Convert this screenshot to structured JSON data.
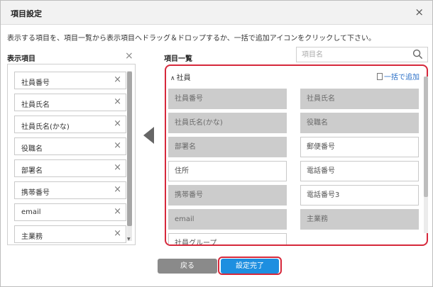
{
  "dialog": {
    "title": "項目設定",
    "close_glyph": "×"
  },
  "instruction": "表示する項目を、項目一覧から表示項目へドラッグ＆ドロップするか、一括で追加アイコンをクリックして下さい。",
  "selected": {
    "title": "表示項目",
    "clear_glyph": "×",
    "items": [
      {
        "label": "社員番号"
      },
      {
        "label": "社員氏名"
      },
      {
        "label": "社員氏名(かな)"
      },
      {
        "label": "役職名"
      },
      {
        "label": "部署名"
      },
      {
        "label": "携帯番号"
      },
      {
        "label": "email"
      },
      {
        "label": "主業務"
      }
    ],
    "remove_glyph": "×"
  },
  "catalog": {
    "title": "項目一覧",
    "search_placeholder": "項目名",
    "group": {
      "name": "社員",
      "bulk_add_label": "一括で追加"
    },
    "fields": [
      {
        "label": "社員番号",
        "used": true
      },
      {
        "label": "社員氏名",
        "used": true
      },
      {
        "label": "社員氏名(かな)",
        "used": true
      },
      {
        "label": "役職名",
        "used": true
      },
      {
        "label": "部署名",
        "used": true
      },
      {
        "label": "郵便番号",
        "used": false
      },
      {
        "label": "住所",
        "used": false
      },
      {
        "label": "電話番号",
        "used": false
      },
      {
        "label": "携帯番号",
        "used": true
      },
      {
        "label": "電話番号3",
        "used": false
      },
      {
        "label": "email",
        "used": true
      },
      {
        "label": "主業務",
        "used": true
      },
      {
        "label": "社員グループ",
        "used": false
      }
    ]
  },
  "buttons": {
    "back": "戻る",
    "done": "設定完了"
  },
  "colors": {
    "highlight": "#d6283b",
    "primary": "#1e8fe0",
    "used_field": "#cccccc",
    "link": "#2a6fc7"
  }
}
